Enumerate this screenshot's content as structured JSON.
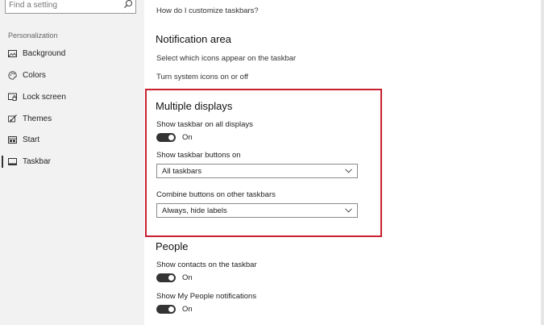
{
  "sidebar": {
    "search_placeholder": "Find a setting",
    "heading": "Personalization",
    "items": [
      {
        "label": "Background",
        "icon": "image-icon"
      },
      {
        "label": "Colors",
        "icon": "palette-icon"
      },
      {
        "label": "Lock screen",
        "icon": "lock-screen-icon"
      },
      {
        "label": "Themes",
        "icon": "themes-brush-icon"
      },
      {
        "label": "Start",
        "icon": "start-menu-icon"
      },
      {
        "label": "Taskbar",
        "icon": "taskbar-icon",
        "active": true
      }
    ]
  },
  "main": {
    "customize_link": "How do I customize taskbars?",
    "notification_area": {
      "title": "Notification area",
      "link_icons": "Select which icons appear on the taskbar",
      "link_system": "Turn system icons on or off"
    },
    "multiple_displays": {
      "title": "Multiple displays",
      "show_all_label": "Show taskbar on all displays",
      "show_all_state": "On",
      "buttons_on_label": "Show taskbar buttons on",
      "buttons_on_value": "All taskbars",
      "combine_label": "Combine buttons on other taskbars",
      "combine_value": "Always, hide labels"
    },
    "people": {
      "title": "People",
      "contacts_label": "Show contacts on the taskbar",
      "contacts_state": "On",
      "notifications_label": "Show My People notifications",
      "notifications_state": "On"
    }
  },
  "colors": {
    "highlight": "#c8202e",
    "toggle_on": "#333333",
    "sidebar_bg": "#f2f2f2"
  }
}
